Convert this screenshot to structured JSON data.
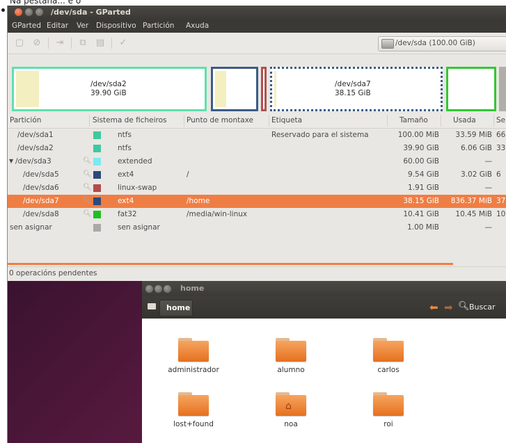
{
  "caption": "Na pestana... e o",
  "gparted": {
    "window_title": "/dev/sda - GParted",
    "menu": [
      "GParted",
      "Editar",
      "Ver",
      "Dispositivo",
      "Partición",
      "Axuda"
    ],
    "toolbar_icons": [
      "new-icon",
      "delete-icon",
      "resize-icon",
      "copy-icon",
      "paste-icon",
      "apply-icon"
    ],
    "device": "/dev/sda  (100.00 GiB)",
    "partition_map": [
      {
        "name": "/dev/sda2",
        "size": "39.90 GiB"
      },
      {
        "name": "/dev/sda7",
        "size": "38.15 GiB"
      }
    ],
    "columns": [
      "Partición",
      "Sistema de ficheiros",
      "Punto de montaxe",
      "Etiqueta",
      "Tamaño",
      "Usada",
      "Se"
    ],
    "rows": [
      {
        "partition": "/dev/sda1",
        "fs": "ntfs",
        "mount": "",
        "label": "Reservado para el sistema",
        "size": "100.00 MiB",
        "used": "33.59 MiB",
        "extra": "66",
        "color": "#3dc9a0",
        "lock": false,
        "expander": false,
        "indent": 1
      },
      {
        "partition": "/dev/sda2",
        "fs": "ntfs",
        "mount": "",
        "label": "",
        "size": "39.90 GiB",
        "used": "6.06 GiB",
        "extra": "33",
        "color": "#3dc9a0",
        "lock": false,
        "expander": false,
        "indent": 1
      },
      {
        "partition": "/dev/sda3",
        "fs": "extended",
        "mount": "",
        "label": "",
        "size": "60.00 GiB",
        "used": "—",
        "extra": "",
        "color": "#7ee9f3",
        "lock": true,
        "expander": true,
        "indent": 0
      },
      {
        "partition": "/dev/sda5",
        "fs": "ext4",
        "mount": "/",
        "label": "",
        "size": "9.54 GiB",
        "used": "3.02 GiB",
        "extra": "6",
        "color": "#2c4a7a",
        "lock": true,
        "expander": false,
        "indent": 2
      },
      {
        "partition": "/dev/sda6",
        "fs": "linux-swap",
        "mount": "",
        "label": "",
        "size": "1.91 GiB",
        "used": "—",
        "extra": "",
        "color": "#b24a4a",
        "lock": true,
        "expander": false,
        "indent": 2
      },
      {
        "partition": "/dev/sda7",
        "fs": "ext4",
        "mount": "/home",
        "label": "",
        "size": "38.15 GiB",
        "used": "836.37 MiB",
        "extra": "37",
        "color": "#2c4a7a",
        "lock": true,
        "expander": false,
        "indent": 2,
        "selected": true
      },
      {
        "partition": "/dev/sda8",
        "fs": "fat32",
        "mount": "/media/win-linux",
        "label": "",
        "size": "10.41 GiB",
        "used": "10.45 MiB",
        "extra": "10",
        "color": "#1fbf1f",
        "lock": true,
        "expander": false,
        "indent": 2
      },
      {
        "partition": "sen asignar",
        "fs": "sen asignar",
        "mount": "",
        "label": "",
        "size": "1.00 MiB",
        "used": "—",
        "extra": "",
        "color": "#a9a9a9",
        "lock": false,
        "expander": false,
        "indent": 0
      }
    ],
    "status": "0 operacións pendentes"
  },
  "file_manager": {
    "title": "home",
    "path": "home",
    "search": "Buscar",
    "folders": [
      {
        "name": "administrador",
        "home": false
      },
      {
        "name": "alumno",
        "home": false
      },
      {
        "name": "carlos",
        "home": false
      },
      {
        "name": "lost+found",
        "home": false
      },
      {
        "name": "noa",
        "home": true
      },
      {
        "name": "roi",
        "home": false
      }
    ]
  }
}
